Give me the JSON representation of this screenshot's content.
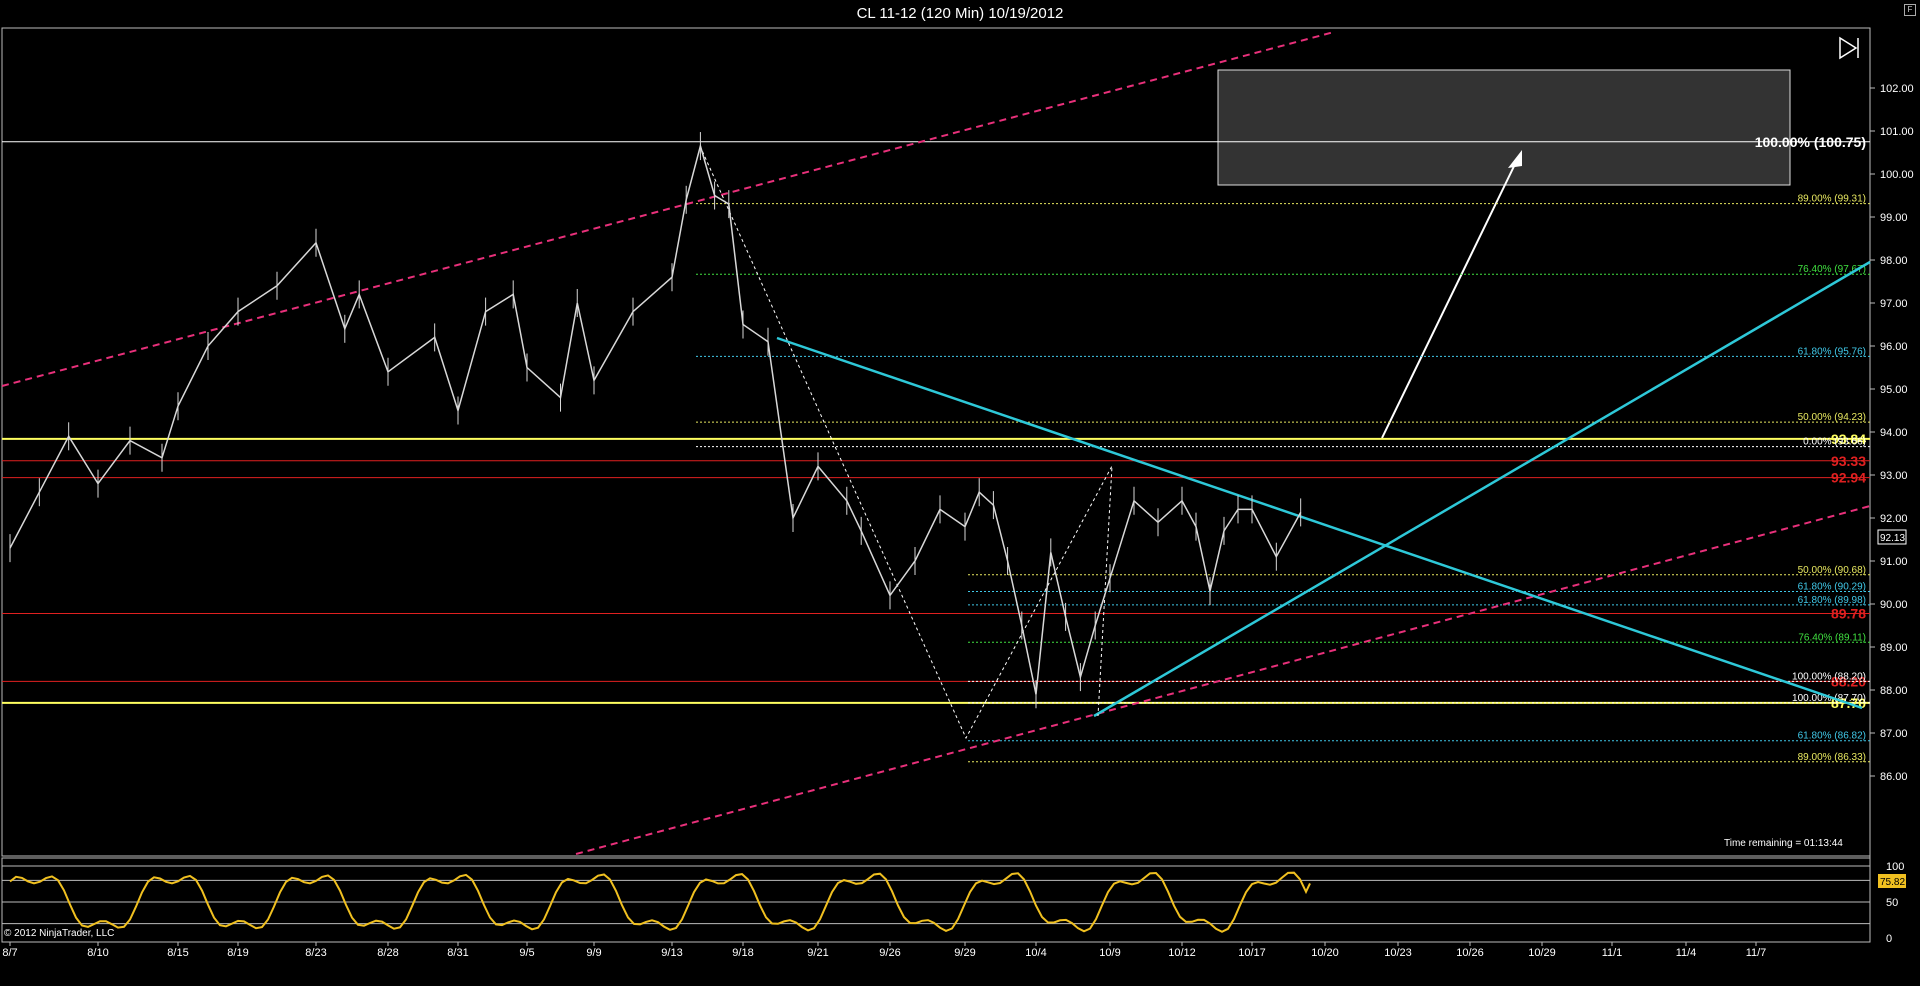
{
  "title": "CL 11-12 (120 Min)  10/19/2012",
  "corner_button": "F",
  "copyright": "© 2012 NinjaTrader, LLC",
  "time_remaining": "Time remaining = 01:13:44",
  "last_price": "92.13",
  "osc_value": "75.82",
  "colors": {
    "background": "#000000",
    "price_bars": "#d8d8d8",
    "channel": "#e8307a",
    "triangle": "#2ec8d8",
    "support_yellow": "#ffff60",
    "level_red": "#e02020",
    "osc_line": "#f0c020",
    "fib_yellow": "#e8e860",
    "fib_green": "#40e040",
    "fib_cyan": "#40c8e8"
  },
  "chart_data": {
    "type": "line",
    "instrument": "CL 11-12 (120 Min)",
    "date": "10/19/2012",
    "x_ticks": [
      "8/7",
      "8/10",
      "8/15",
      "8/19",
      "8/23",
      "8/28",
      "8/31",
      "9/5",
      "9/9",
      "9/13",
      "9/18",
      "9/21",
      "9/26",
      "9/29",
      "10/4",
      "10/9",
      "10/12",
      "10/17",
      "10/20",
      "10/23",
      "10/26",
      "10/29",
      "11/1",
      "11/4",
      "11/7"
    ],
    "y_ticks": [
      "102.00",
      "101.00",
      "100.00",
      "99.00",
      "98.00",
      "97.00",
      "96.00",
      "95.00",
      "94.00",
      "93.00",
      "92.00",
      "91.00",
      "90.00",
      "89.00",
      "88.00",
      "87.00",
      "86.00"
    ],
    "ylim": [
      85.3,
      102.8
    ],
    "price_path": [
      {
        "x": "8/7",
        "y": 91.3
      },
      {
        "x": "8/8",
        "y": 92.6
      },
      {
        "x": "8/9",
        "y": 93.9
      },
      {
        "x": "8/10",
        "y": 92.8
      },
      {
        "x": "8/12",
        "y": 93.8
      },
      {
        "x": "8/14",
        "y": 93.4
      },
      {
        "x": "8/15",
        "y": 94.6
      },
      {
        "x": "8/17",
        "y": 96.0
      },
      {
        "x": "8/19",
        "y": 96.8
      },
      {
        "x": "8/21",
        "y": 97.4
      },
      {
        "x": "8/23",
        "y": 98.4
      },
      {
        "x": "8/25",
        "y": 96.4
      },
      {
        "x": "8/26",
        "y": 97.2
      },
      {
        "x": "8/28",
        "y": 95.4
      },
      {
        "x": "8/30",
        "y": 96.2
      },
      {
        "x": "8/31",
        "y": 94.5
      },
      {
        "x": "9/2",
        "y": 96.8
      },
      {
        "x": "9/4",
        "y": 97.2
      },
      {
        "x": "9/5",
        "y": 95.5
      },
      {
        "x": "9/7",
        "y": 94.8
      },
      {
        "x": "9/8",
        "y": 97.0
      },
      {
        "x": "9/9",
        "y": 95.2
      },
      {
        "x": "9/11",
        "y": 96.8
      },
      {
        "x": "9/13",
        "y": 97.6
      },
      {
        "x": "9/14",
        "y": 99.4
      },
      {
        "x": "9/15",
        "y": 100.65
      },
      {
        "x": "9/16",
        "y": 99.5
      },
      {
        "x": "9/17",
        "y": 99.3
      },
      {
        "x": "9/18",
        "y": 96.5
      },
      {
        "x": "9/19",
        "y": 96.1
      },
      {
        "x": "9/20",
        "y": 92.0
      },
      {
        "x": "9/21",
        "y": 93.2
      },
      {
        "x": "9/23",
        "y": 92.4
      },
      {
        "x": "9/24",
        "y": 91.7
      },
      {
        "x": "9/26",
        "y": 90.2
      },
      {
        "x": "9/27",
        "y": 91.0
      },
      {
        "x": "9/28",
        "y": 92.2
      },
      {
        "x": "9/29",
        "y": 91.8
      },
      {
        "x": "9/30",
        "y": 92.6
      },
      {
        "x": "10/1",
        "y": 92.3
      },
      {
        "x": "10/2",
        "y": 91.0
      },
      {
        "x": "10/3",
        "y": 89.5
      },
      {
        "x": "10/4",
        "y": 87.9
      },
      {
        "x": "10/5",
        "y": 91.2
      },
      {
        "x": "10/6",
        "y": 89.7
      },
      {
        "x": "10/7",
        "y": 88.3
      },
      {
        "x": "10/8",
        "y": 89.5
      },
      {
        "x": "10/9",
        "y": 90.6
      },
      {
        "x": "10/10",
        "y": 92.4
      },
      {
        "x": "10/11",
        "y": 91.9
      },
      {
        "x": "10/12",
        "y": 92.4
      },
      {
        "x": "10/13",
        "y": 91.8
      },
      {
        "x": "10/14",
        "y": 90.3
      },
      {
        "x": "10/15",
        "y": 91.7
      },
      {
        "x": "10/16",
        "y": 92.2
      },
      {
        "x": "10/17",
        "y": 92.2
      },
      {
        "x": "10/18",
        "y": 91.1
      },
      {
        "x": "10/19",
        "y": 92.13
      }
    ],
    "horizontal_levels": [
      {
        "price": 100.75,
        "color": "#ffffff",
        "label": "100.00% (100.75)"
      },
      {
        "price": 93.84,
        "color": "#ffff60",
        "label": "93.84",
        "style": "big"
      },
      {
        "price": 93.33,
        "color": "#e02020",
        "label": "93.33",
        "style": "big"
      },
      {
        "price": 92.94,
        "color": "#e02020",
        "label": "92.94",
        "style": "big"
      },
      {
        "price": 89.78,
        "color": "#e02020",
        "label": "89.78",
        "style": "big"
      },
      {
        "price": 88.2,
        "color": "#e02020",
        "label": "88.20",
        "style": "big"
      },
      {
        "price": 87.7,
        "color": "#ffff60",
        "label": "87.70",
        "style": "big"
      }
    ],
    "fib_levels": [
      {
        "price": 99.31,
        "color": "#e8e860",
        "label": "89.00% (99.31)"
      },
      {
        "price": 97.67,
        "color": "#40e040",
        "label": "76.40% (97.67)"
      },
      {
        "price": 95.76,
        "color": "#40c8e8",
        "label": "61.80% (95.76)"
      },
      {
        "price": 94.23,
        "color": "#e8e860",
        "label": "50.00% (94.23)"
      },
      {
        "price": 93.66,
        "color": "#ffffff",
        "label": "0.00% (93.66)"
      },
      {
        "price": 90.68,
        "color": "#e8e860",
        "label": "50.00% (90.68)"
      },
      {
        "price": 90.29,
        "color": "#40c8e8",
        "label": "61.80% (90.29)"
      },
      {
        "price": 89.98,
        "color": "#40c8e8",
        "label": "61.80% (89.98)"
      },
      {
        "price": 89.11,
        "color": "#40e040",
        "label": "76.40% (89.11)"
      },
      {
        "price": 88.2,
        "color": "#ffffff",
        "label": "100.00% (88.20)"
      },
      {
        "price": 87.7,
        "color": "#ffffff",
        "label": "100.00% (87.70)"
      },
      {
        "price": 86.82,
        "color": "#40c8e8",
        "label": "61.80% (86.82)"
      },
      {
        "price": 86.33,
        "color": "#e8e860",
        "label": "89.00% (86.33)"
      }
    ],
    "oscillator": {
      "y_ticks": [
        "100",
        "50",
        "0"
      ],
      "ylim": [
        0,
        100
      ],
      "current": 75.82
    }
  }
}
